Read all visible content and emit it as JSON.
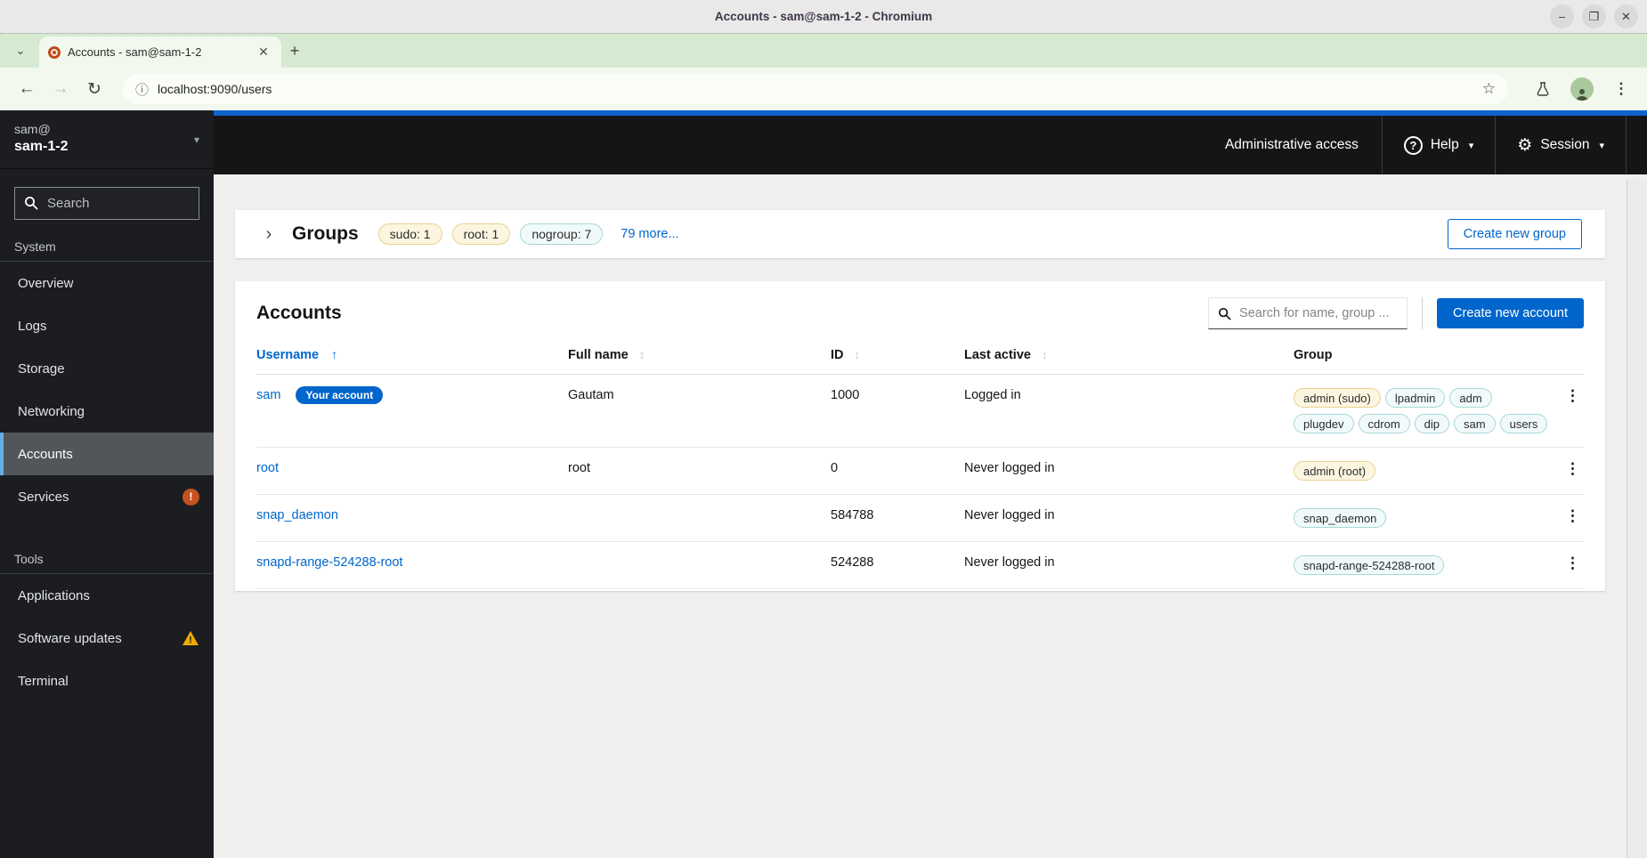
{
  "window": {
    "title": "Accounts - sam@sam-1-2 - Chromium",
    "controls": {
      "minimize": "–",
      "maximize": "❐",
      "close": "✕"
    }
  },
  "browser": {
    "tab_title": "Accounts - sam@sam-1-2",
    "url": "localhost:9090/users",
    "glyphs": {
      "tab_search": "⌄",
      "tab_close": "✕",
      "new_tab": "+",
      "back": "←",
      "forward": "→",
      "reload": "↻",
      "info": "ⓘ",
      "star": "☆",
      "menu": "⋮"
    }
  },
  "sidebar": {
    "user": "sam@",
    "host": "sam-1-2",
    "search_placeholder": "Search",
    "sections": [
      {
        "label": "System",
        "items": [
          {
            "label": "Overview"
          },
          {
            "label": "Logs"
          },
          {
            "label": "Storage"
          },
          {
            "label": "Networking"
          },
          {
            "label": "Accounts",
            "active": true
          },
          {
            "label": "Services",
            "danger_badge": "!"
          }
        ]
      },
      {
        "label": "Tools",
        "items": [
          {
            "label": "Applications"
          },
          {
            "label": "Software updates",
            "warning": true
          },
          {
            "label": "Terminal"
          }
        ]
      }
    ]
  },
  "masthead": {
    "admin_access": "Administrative access",
    "help": "Help",
    "session": "Session",
    "caret": "▾"
  },
  "groups": {
    "title": "Groups",
    "expand_glyph": "›",
    "badges": [
      {
        "label": "sudo: 1",
        "variant": "gold"
      },
      {
        "label": "root: 1",
        "variant": "gold"
      },
      {
        "label": "nogroup: 7",
        "variant": "cyan"
      }
    ],
    "more_link": "79 more...",
    "create_button": "Create new group"
  },
  "accounts": {
    "title": "Accounts",
    "search_placeholder": "Search for name, group ...",
    "create_button": "Create new account",
    "columns": [
      {
        "label": "Username",
        "sort": "active-asc"
      },
      {
        "label": "Full name",
        "sort": "sortable"
      },
      {
        "label": "ID",
        "sort": "sortable"
      },
      {
        "label": "Last active",
        "sort": "sortable"
      },
      {
        "label": "Group",
        "sort": "none"
      }
    ],
    "rows": [
      {
        "username": "sam",
        "badge": "Your account",
        "full_name": "Gautam",
        "id": "1000",
        "last_active": "Logged in",
        "groups": [
          {
            "label": "admin (sudo)",
            "variant": "gold"
          },
          {
            "label": "lpadmin",
            "variant": "cyan"
          },
          {
            "label": "adm",
            "variant": "cyan"
          },
          {
            "label": "plugdev",
            "variant": "cyan"
          },
          {
            "label": "cdrom",
            "variant": "cyan"
          },
          {
            "label": "dip",
            "variant": "cyan"
          },
          {
            "label": "sam",
            "variant": "cyan"
          },
          {
            "label": "users",
            "variant": "cyan"
          }
        ]
      },
      {
        "username": "root",
        "full_name": "root",
        "id": "0",
        "last_active": "Never logged in",
        "groups": [
          {
            "label": "admin (root)",
            "variant": "gold"
          }
        ]
      },
      {
        "username": "snap_daemon",
        "full_name": "",
        "id": "584788",
        "last_active": "Never logged in",
        "groups": [
          {
            "label": "snap_daemon",
            "variant": "cyan"
          }
        ]
      },
      {
        "username": "snapd-range-524288-root",
        "full_name": "",
        "id": "524288",
        "last_active": "Never logged in",
        "groups": [
          {
            "label": "snapd-range-524288-root",
            "variant": "cyan"
          }
        ]
      }
    ],
    "row_menu_glyph": "⋮",
    "sort_up_glyph": "↑",
    "sort_both_glyph": "↕"
  },
  "colors": {
    "accent_blue": "#0066cc",
    "page_accent_bar": "#0d64cc",
    "masthead_bg": "#151515",
    "sidebar_bg": "#1b1d21",
    "nav_selected_border": "#64aee4",
    "warning_triangle": "#f0ab00",
    "danger_badge": "#c65120",
    "badge_gold_bg": "#fcf6e1",
    "badge_gold_border": "#e9d18f",
    "badge_cyan_bg": "#f1fafa",
    "badge_cyan_border": "#a8d7d7"
  }
}
